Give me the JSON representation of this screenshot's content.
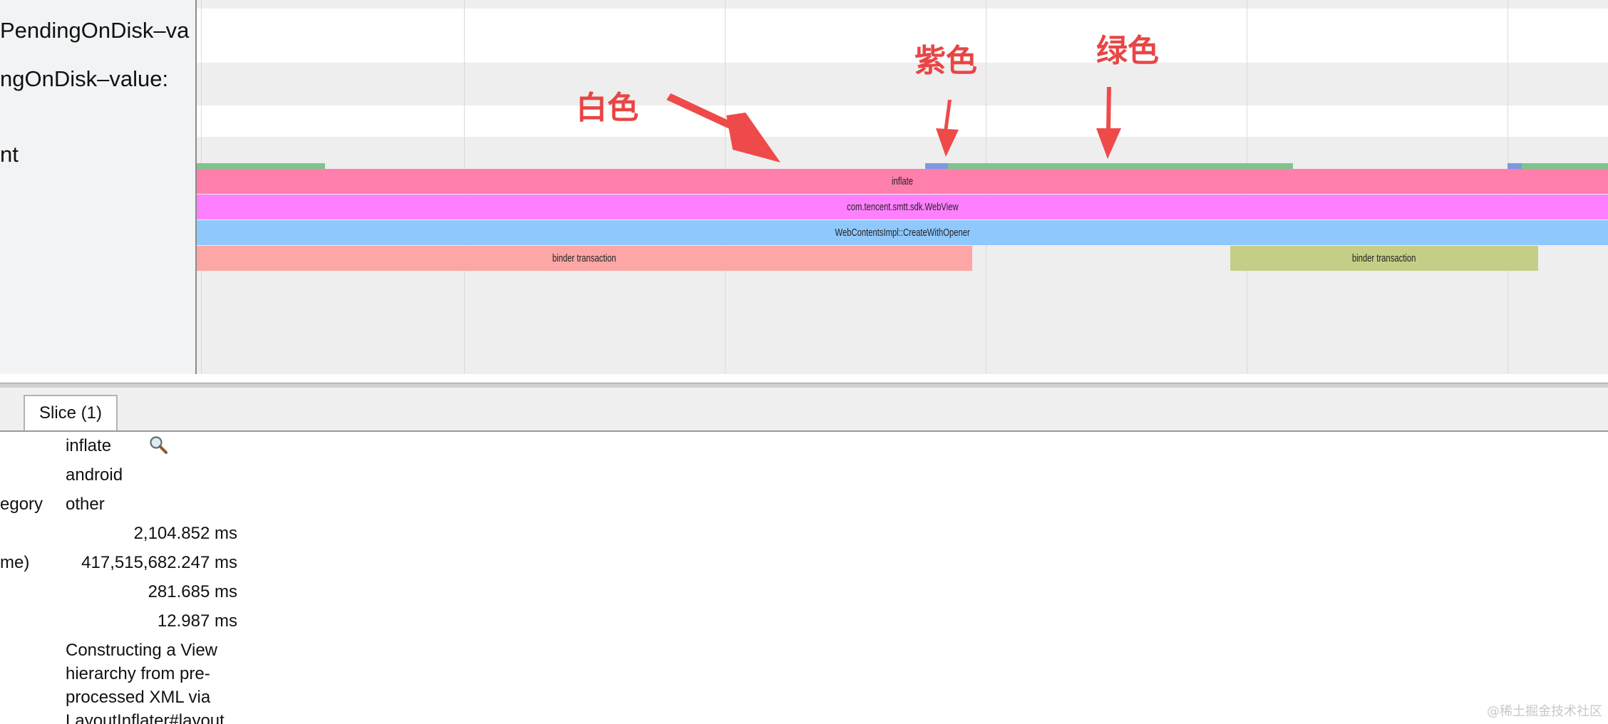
{
  "tracks": {
    "label_1": "PendingOnDisk–va",
    "label_2": "ngOnDisk–value:",
    "label_3": "nt"
  },
  "slices": {
    "inflate": "inflate",
    "webview": "com.tencent.smtt.sdk.WebView",
    "create": "WebContentsImpl::CreateWithOpener",
    "binder_1": "binder transaction",
    "binder_2": "binder transaction"
  },
  "annotations": {
    "white": "白色",
    "purple": "紫色",
    "green": "绿色"
  },
  "colors": {
    "inflate": "#ff7fac",
    "webview": "#ff80ff",
    "create": "#8fc8fd",
    "binder_1": "#fca6a6",
    "binder_2": "#c4ce86",
    "state_running": "#7fc48d",
    "state_runnable": "#7e98e2",
    "annotation": "#e84545"
  },
  "tab": {
    "label": "Slice (1)"
  },
  "details": {
    "name_value": "inflate",
    "category_value": "android",
    "row3_label": "egory",
    "row3_value": "other",
    "duration": "2,104.852 ms",
    "row5_label": "me)",
    "start_time": "417,515,682.247 ms",
    "thread_duration": "281.685 ms",
    "self_time": "12.987 ms",
    "description": "Constructing a View hierarchy from pre-processed XML via LayoutInflater#layout"
  },
  "icons": {
    "search": "search-icon"
  },
  "watermark": "@稀土掘金技术社区"
}
